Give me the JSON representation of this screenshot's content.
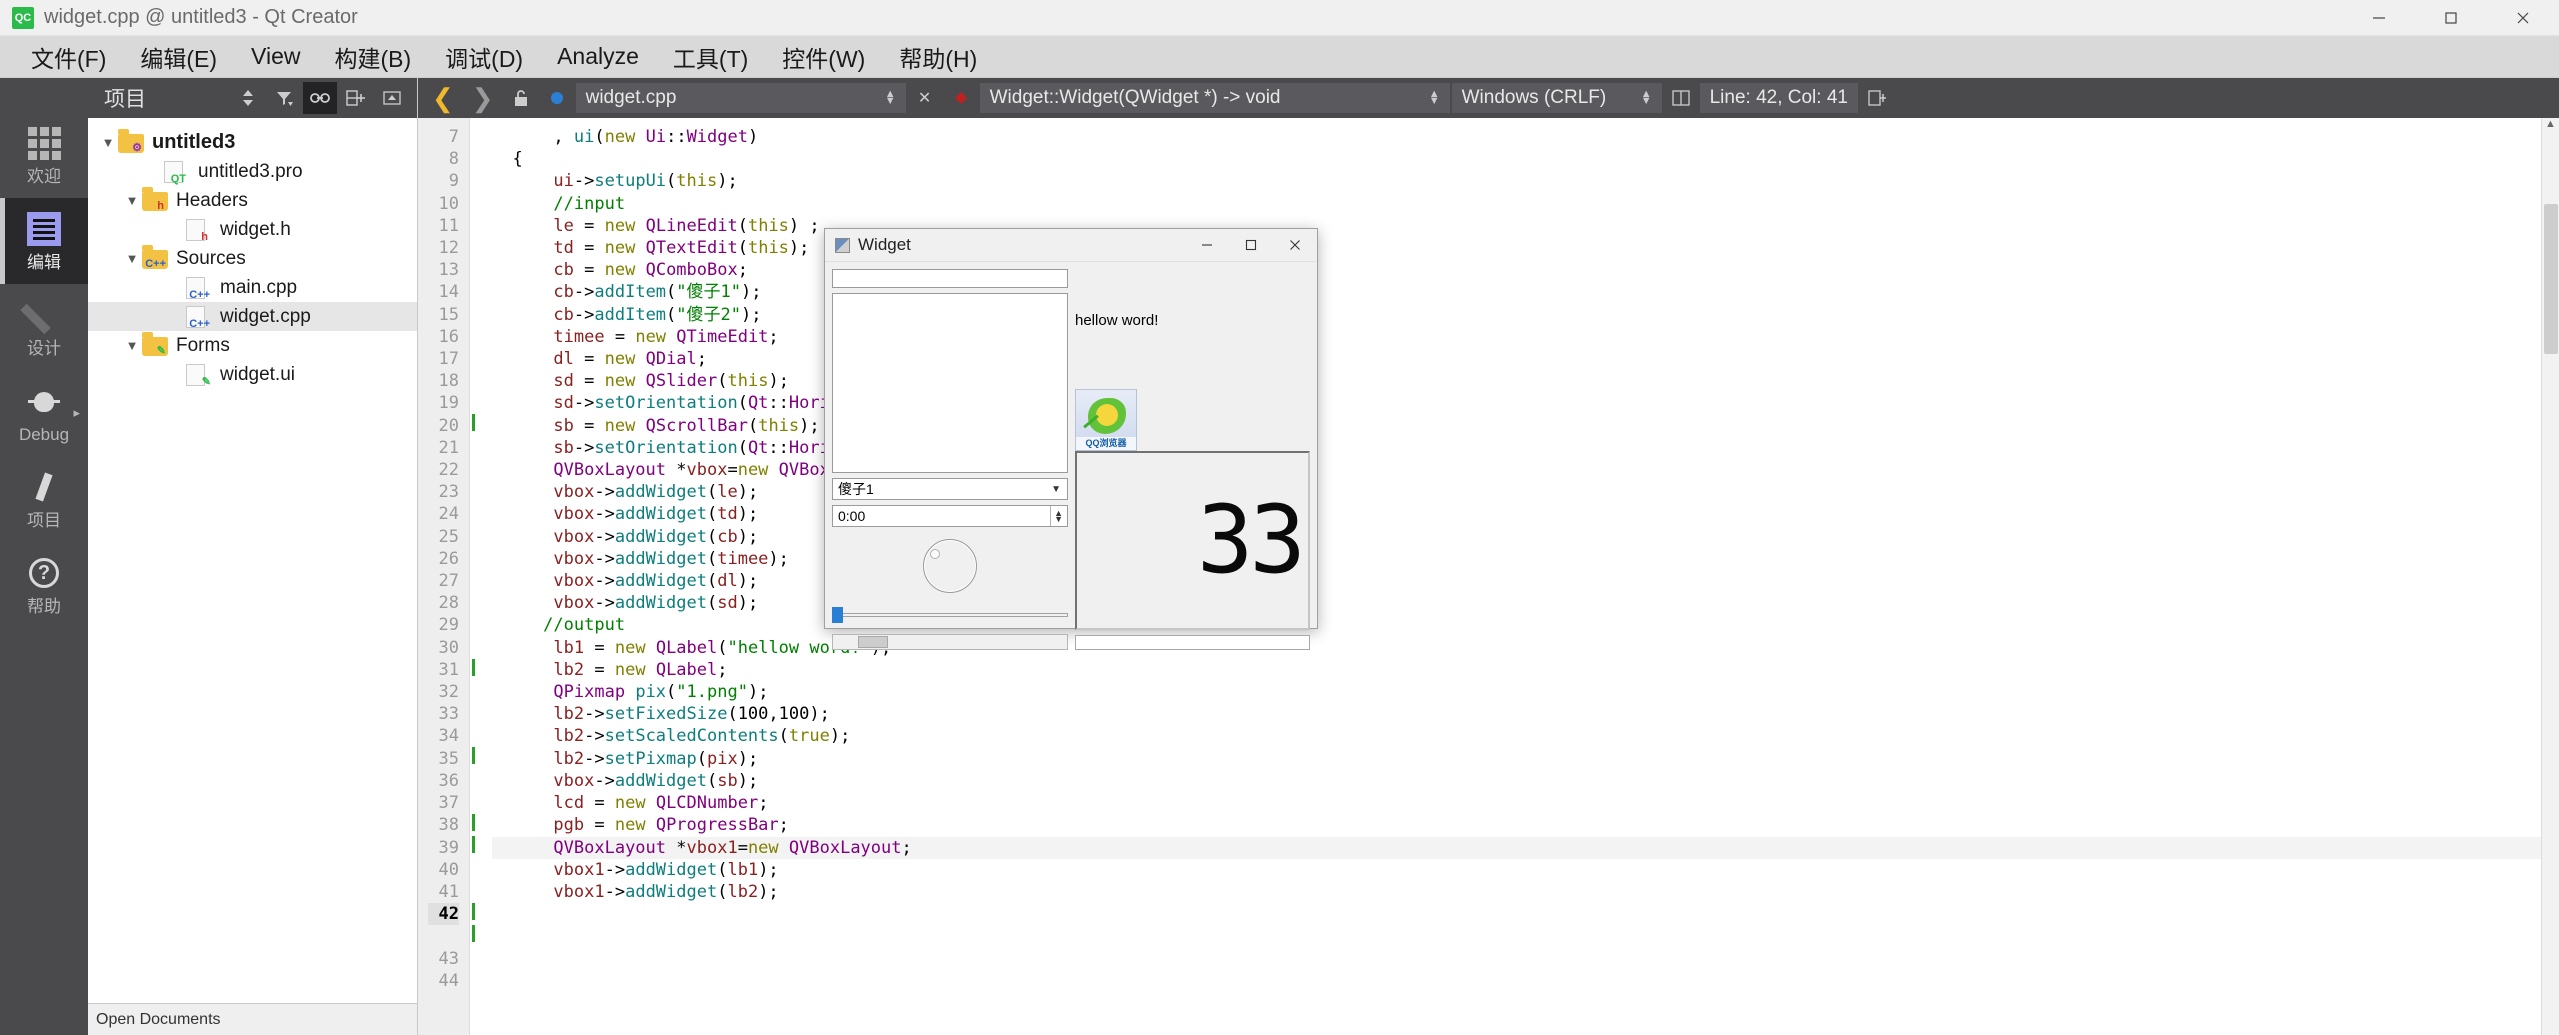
{
  "titlebar": {
    "app_icon": "qtcreator-icon",
    "logo_text": "QC",
    "title": "widget.cpp @ untitled3 - Qt Creator",
    "minimize": "─",
    "maximize": "□",
    "close": "✕"
  },
  "menubar": {
    "items": [
      {
        "label": "文件(F)"
      },
      {
        "label": "编辑(E)"
      },
      {
        "label": "View"
      },
      {
        "label": "构建(B)"
      },
      {
        "label": "调试(D)"
      },
      {
        "label": "Analyze"
      },
      {
        "label": "工具(T)"
      },
      {
        "label": "控件(W)"
      },
      {
        "label": "帮助(H)"
      }
    ]
  },
  "modebar": {
    "items": [
      {
        "label": "欢迎",
        "icon": "grid-icon",
        "active": false
      },
      {
        "label": "编辑",
        "icon": "edit-icon",
        "active": true
      },
      {
        "label": "设计",
        "icon": "pencil-icon",
        "active": false
      },
      {
        "label": "Debug",
        "icon": "bug-icon",
        "active": false
      },
      {
        "label": "项目",
        "icon": "wrench-icon",
        "active": false
      },
      {
        "label": "帮助",
        "icon": "help-icon",
        "active": false
      }
    ]
  },
  "project_panel": {
    "title": "项目",
    "toolbar": {
      "sync_selector": "updown-arrows-icon",
      "filter": "filter-icon",
      "link": "link-icon",
      "split": "split-add-icon",
      "close": "close-pane-icon"
    },
    "tree": [
      {
        "label": "untitled3",
        "indent": 0,
        "arrow": "▼",
        "icon": "folder-project-icon",
        "bold": true,
        "selected": false
      },
      {
        "label": "untitled3.pro",
        "indent": 1,
        "arrow": "",
        "icon": "qt-pro-file-icon",
        "bold": false,
        "selected": false
      },
      {
        "label": "Headers",
        "indent": 1,
        "arrow": "▼",
        "icon": "folder-headers-icon",
        "bold": false,
        "selected": false
      },
      {
        "label": "widget.h",
        "indent": 2,
        "arrow": "",
        "icon": "h-file-icon",
        "bold": false,
        "selected": false
      },
      {
        "label": "Sources",
        "indent": 1,
        "arrow": "▼",
        "icon": "folder-sources-icon",
        "bold": false,
        "selected": false
      },
      {
        "label": "main.cpp",
        "indent": 2,
        "arrow": "",
        "icon": "cpp-file-icon",
        "bold": false,
        "selected": false
      },
      {
        "label": "widget.cpp",
        "indent": 2,
        "arrow": "",
        "icon": "cpp-file-icon",
        "bold": false,
        "selected": true
      },
      {
        "label": "Forms",
        "indent": 1,
        "arrow": "▼",
        "icon": "folder-forms-icon",
        "bold": false,
        "selected": false
      },
      {
        "label": "widget.ui",
        "indent": 2,
        "arrow": "",
        "icon": "ui-file-icon",
        "bold": false,
        "selected": false
      }
    ],
    "footer": "Open Documents"
  },
  "editor": {
    "toolbar": {
      "back": "❮",
      "forward": "❯",
      "lock": "unlock-icon",
      "file_name": "widget.cpp",
      "symbol": "Widget::Widget(QWidget *) -> void",
      "close_file": "✕",
      "encoding": "Windows (CRLF)",
      "cursor_position": "Line: 42, Col: 41",
      "split_editor": "split-editor-icon"
    },
    "first_line_number": 7,
    "current_line": 42,
    "changed_lines": [
      20,
      31,
      35,
      38,
      39,
      42,
      43
    ],
    "lines": [
      {
        "n": 7,
        "text": "      , ui(new Ui::Widget)"
      },
      {
        "n": 8,
        "text": "  {"
      },
      {
        "n": 9,
        "text": "      ui->setupUi(this);"
      },
      {
        "n": 10,
        "text": ""
      },
      {
        "n": 11,
        "text": "      //input"
      },
      {
        "n": 12,
        "text": "      le = new QLineEdit(this) ;"
      },
      {
        "n": 13,
        "text": "      td = new QTextEdit(this);"
      },
      {
        "n": 14,
        "text": "      cb = new QComboBox;"
      },
      {
        "n": 15,
        "text": "      cb->addItem(\"傻子1\");"
      },
      {
        "n": 16,
        "text": "      cb->addItem(\"傻子2\");"
      },
      {
        "n": 17,
        "text": ""
      },
      {
        "n": 18,
        "text": "      timee = new QTimeEdit;"
      },
      {
        "n": 19,
        "text": ""
      },
      {
        "n": 20,
        "text": "      dl = new QDial;"
      },
      {
        "n": 21,
        "text": "      sd = new QSlider(this);"
      },
      {
        "n": 22,
        "text": "      sd->setOrientation(Qt::Horizontal);"
      },
      {
        "n": 23,
        "text": "      sb = new QScrollBar(this);"
      },
      {
        "n": 24,
        "text": "      sb->setOrientation(Qt::Horizontal);"
      },
      {
        "n": 25,
        "text": "      QVBoxLayout *vbox=new QVBoxLayout;"
      },
      {
        "n": 26,
        "text": "      vbox->addWidget(le);"
      },
      {
        "n": 27,
        "text": "      vbox->addWidget(td);"
      },
      {
        "n": 28,
        "text": "      vbox->addWidget(cb);"
      },
      {
        "n": 29,
        "text": "      vbox->addWidget(timee);"
      },
      {
        "n": 30,
        "text": "      vbox->addWidget(dl);"
      },
      {
        "n": 31,
        "text": "      vbox->addWidget(sd);"
      },
      {
        "n": 32,
        "text": "     //output"
      },
      {
        "n": 33,
        "text": "      lb1 = new QLabel(\"hellow word!\");"
      },
      {
        "n": 34,
        "text": "      lb2 = new QLabel;"
      },
      {
        "n": 35,
        "text": "      QPixmap pix(\"1.png\");"
      },
      {
        "n": 36,
        "text": "      lb2->setFixedSize(100,100);"
      },
      {
        "n": 37,
        "text": "      lb2->setScaledContents(true);"
      },
      {
        "n": 38,
        "text": "      lb2->setPixmap(pix);"
      },
      {
        "n": 39,
        "text": "      vbox->addWidget(sb);"
      },
      {
        "n": 40,
        "text": "      lcd = new QLCDNumber;"
      },
      {
        "n": 41,
        "text": "      pgb = new QProgressBar;"
      },
      {
        "n": 42,
        "text": "      QVBoxLayout *vbox1=new QVBoxLayout;"
      },
      {
        "n": 43,
        "text": "      vbox1->addWidget(lb1);"
      },
      {
        "n": 44,
        "text": "      vbox1->addWidget(lb2);"
      }
    ]
  },
  "widget_window": {
    "title": "Widget",
    "minimize": "─",
    "maximize": "□",
    "close": "✕",
    "line_edit_value": "",
    "text_edit_value": "",
    "combo_value": "傻子1",
    "time_value": "0:00",
    "dial_value": "",
    "label_text": "hellow word!",
    "pixmap_caption": "QQ浏览器",
    "lcd_value": "33",
    "progress_value": ""
  },
  "colors": {
    "accent_yellow": "#f0b82b",
    "mode_active_bg": "#29292b",
    "panel_dark": "#4a4a4d",
    "slider_blue": "#2a7fd4",
    "comment_green": "#008000",
    "type_purple": "#800080"
  }
}
